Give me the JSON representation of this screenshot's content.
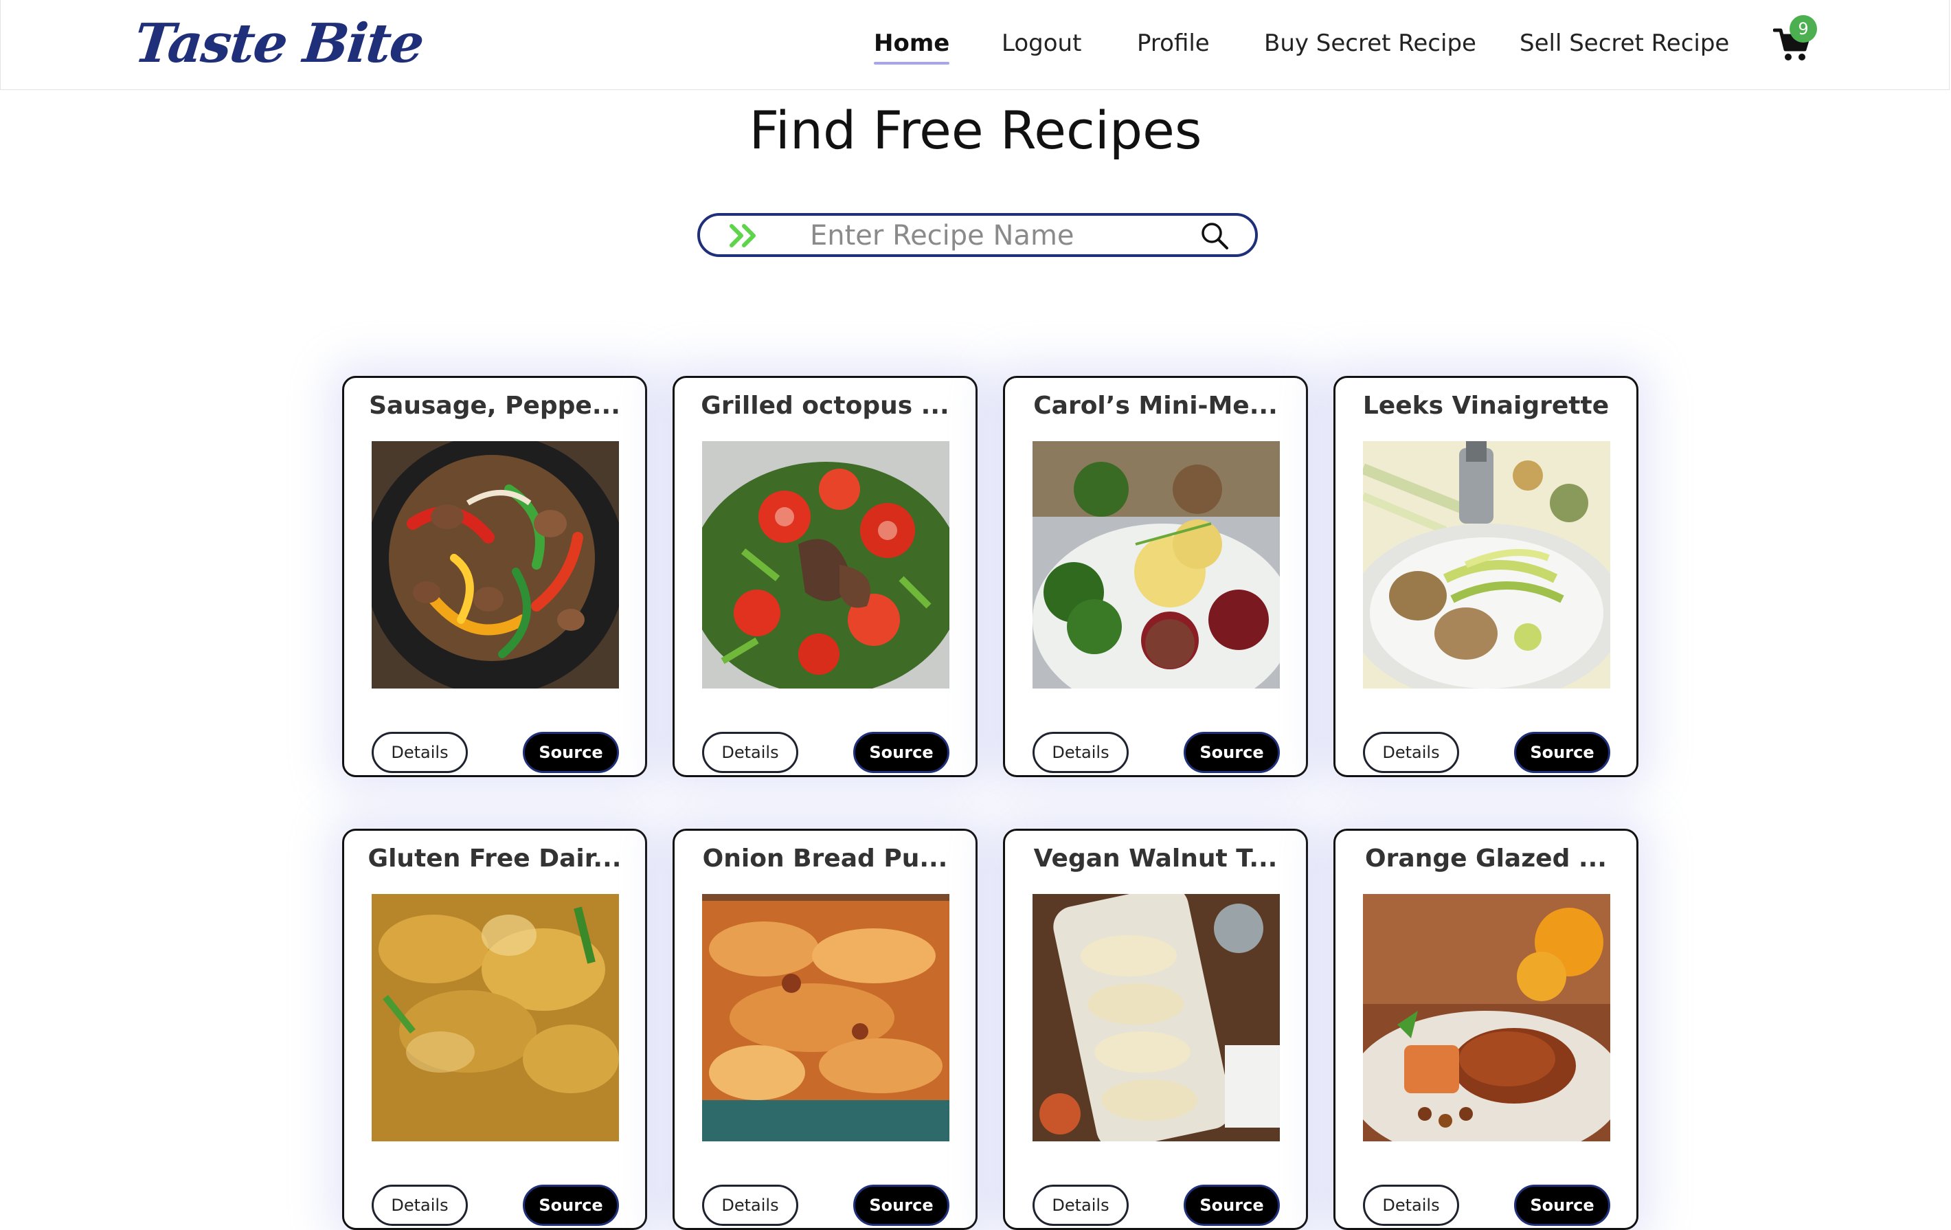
{
  "brand": {
    "logo_text": "Taste Bite",
    "color": "#1f2f7a"
  },
  "nav": {
    "items": [
      {
        "label": "Home",
        "active": true
      },
      {
        "label": "Logout"
      },
      {
        "label": "Profile"
      },
      {
        "label": "Buy Secret Recipe"
      },
      {
        "label": "Sell Secret Recipe"
      }
    ],
    "cart_count": "9",
    "cart_icon": "shopping-cart-icon",
    "badge_color": "#4caf50"
  },
  "main": {
    "title": "Find Free Recipes",
    "search": {
      "placeholder": "Enter Recipe Name",
      "value": "",
      "leading_icon": "double-chevron-right-icon",
      "trailing_icon": "search-icon",
      "accent": "#5dd44a"
    }
  },
  "buttons": {
    "details": "Details",
    "source": "Source"
  },
  "recipes": [
    {
      "title": "Sausage, Peppe...",
      "image": "sausage-peppers-skillet"
    },
    {
      "title": "Grilled octopus ...",
      "image": "grilled-octopus-salad"
    },
    {
      "title": "Carol’s Mini-Me...",
      "image": "mini-meatloaf-plate"
    },
    {
      "title": "Leeks Vinaigrette",
      "image": "leeks-vinaigrette-plate"
    },
    {
      "title": "Gluten Free Dair...",
      "image": "curry-dish"
    },
    {
      "title": "Onion Bread Pu...",
      "image": "onion-bread-pudding"
    },
    {
      "title": "Vegan Walnut T...",
      "image": "vegan-walnut-tacos"
    },
    {
      "title": "Orange Glazed ...",
      "image": "orange-glazed-chicken"
    }
  ]
}
